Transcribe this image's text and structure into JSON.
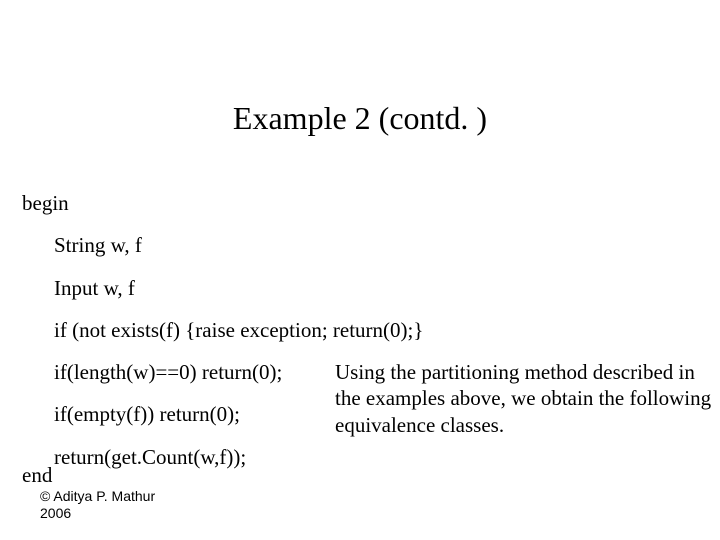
{
  "title": "Example 2 (contd. )",
  "code": {
    "begin": "begin",
    "l1": "String w, f",
    "l2": "Input w, f",
    "l3": "if (not exists(f) {raise exception; return(0);}",
    "l4": "if(length(w)==0) return(0);",
    "l5": "if(empty(f)) return(0);",
    "l6": "return(get.Count(w,f));",
    "end": "end"
  },
  "note": "Using the partitioning method described in the examples above, we obtain the following equivalence classes.",
  "copyright": {
    "line1": "© Aditya P. Mathur",
    "line2": "2006"
  }
}
